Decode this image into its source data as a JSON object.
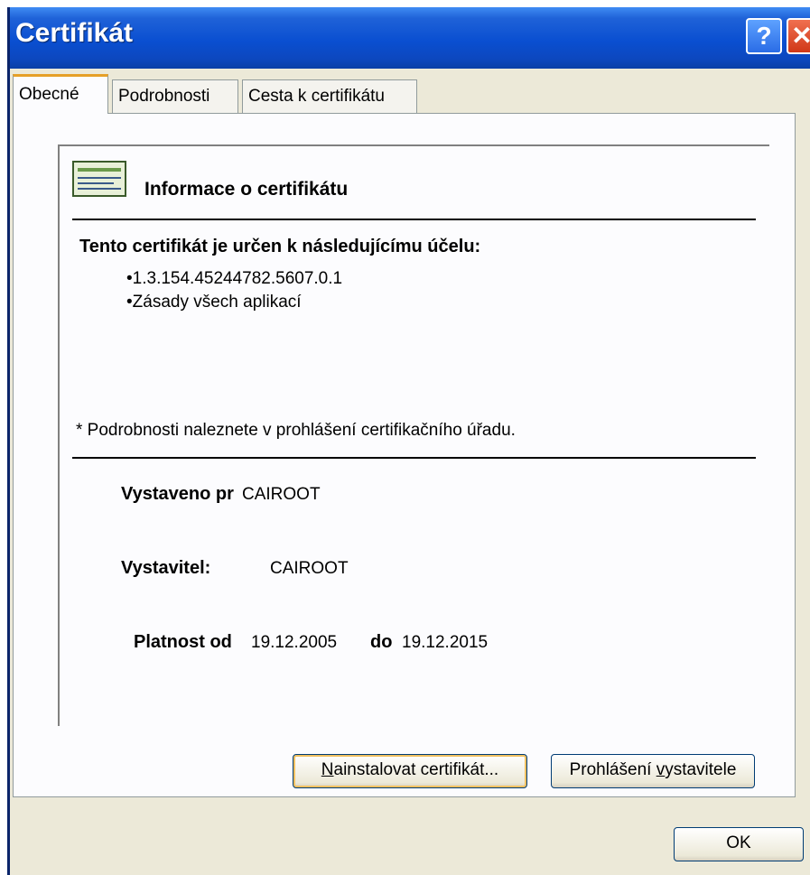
{
  "window": {
    "title": "Certifikát",
    "help_label": "?",
    "close_label": "✕"
  },
  "tabs": [
    {
      "label": "Obecné",
      "active": true
    },
    {
      "label": "Podrobnosti",
      "active": false
    },
    {
      "label": "Cesta k certifikátu",
      "active": false
    }
  ],
  "info": {
    "icon": "certificate-icon",
    "title": "Informace o certifikátu",
    "purpose_heading": "Tento certifikát je určen k následujícímu účelu:",
    "purposes": [
      "•1.3.154.45244782.5607.0.1",
      "•Zásady všech aplikací"
    ],
    "note": "* Podrobnosti naleznete v prohlášení certifikačního úřadu.",
    "issued_to_label": "Vystaveno pr",
    "issued_to_value": "CAIROOT",
    "issuer_label": "Vystavitel:",
    "issuer_value": "CAIROOT",
    "valid_from_label": "Platnost od",
    "valid_from_value": "19.12.2005",
    "valid_to_label": "do",
    "valid_to_value": "19.12.2015"
  },
  "buttons": {
    "install_mnemonic": "N",
    "install_rest": "ainstalovat certifikát...",
    "statement_prefix": "Prohlášení ",
    "statement_mnemonic": "v",
    "statement_rest": "ystavitele",
    "ok": "OK"
  }
}
